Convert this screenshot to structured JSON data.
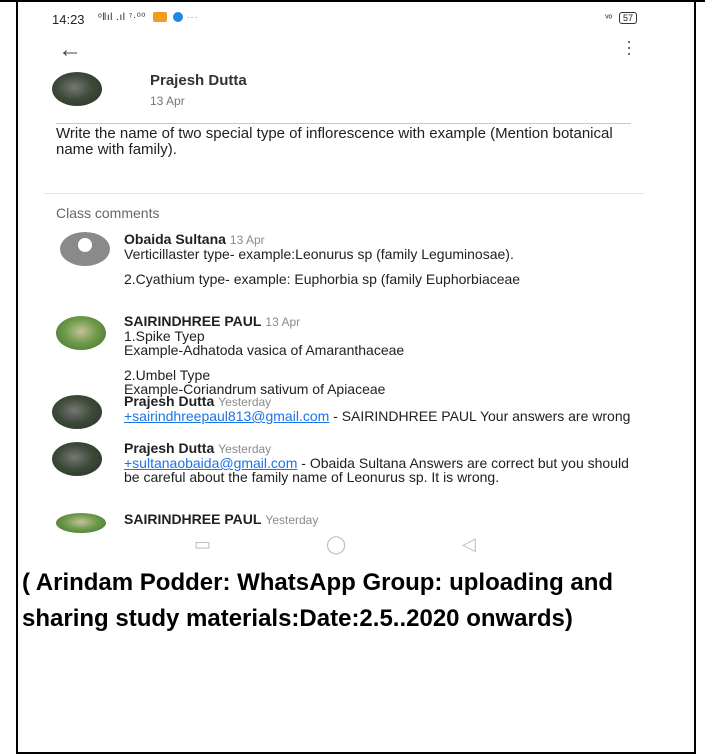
{
  "status_bar": {
    "time": "14:23",
    "signal_text": "ᵒ‖ıl .ıl ⁷·⁰⁰",
    "right_text": "ᵛᵒ",
    "battery": "57"
  },
  "post": {
    "author": "Prajesh Dutta",
    "date": "13 Apr",
    "text": "Write the name of two special type of inflorescence with example (Mention botanical name with family)."
  },
  "class_comments_label": "Class comments",
  "comments": [
    {
      "name": "Obaida Sultana",
      "date": "13 Apr",
      "line1": "Verticillaster type- example:Leonurus sp (family Leguminosae).",
      "line2": "2.Cyathium type- example: Euphorbia sp (family Euphorbiaceae"
    },
    {
      "name": "SAIRINDHREE PAUL",
      "date": "13 Apr",
      "line1a": "1.Spike Tyep",
      "line1b": "Example-Adhatoda vasica of Amaranthaceae",
      "line2a": "2.Umbel Type",
      "line2b": "Example-Coriandrum sativum of Apiaceae"
    },
    {
      "name": "Prajesh Dutta",
      "date": "Yesterday",
      "mention": "+sairindhreepaul813@gmail.com",
      "text": " - SAIRINDHREE PAUL Your answers are wrong"
    },
    {
      "name": "Prajesh Dutta",
      "date": "Yesterday",
      "mention": "+sultanaobaida@gmail.com",
      "text": " - Obaida Sultana Answers are correct but you should be careful about the family name of Leonurus sp. It is wrong."
    },
    {
      "name": "SAIRINDHREE PAUL",
      "date": "Yesterday"
    }
  ],
  "caption": "( Arindam Podder: WhatsApp Group: uploading and sharing study materials:Date:2.5..2020 onwards)",
  "colors": {
    "link": "#1a73e8",
    "text": "#202124",
    "muted": "#8a8a8a"
  },
  "icons": [
    "back-arrow-icon",
    "overflow-menu-icon",
    "nav-recents-icon",
    "nav-home-icon",
    "nav-back-icon"
  ]
}
